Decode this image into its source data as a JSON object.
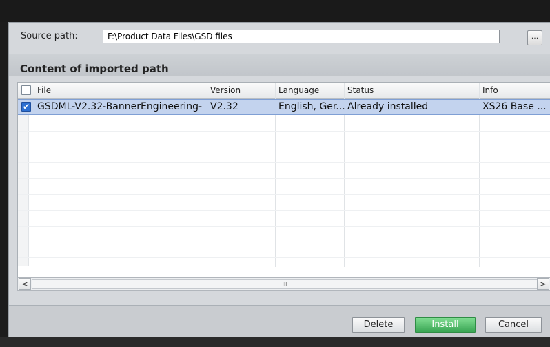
{
  "source": {
    "label": "Source path:",
    "value": "F:\\Product Data Files\\GSD files",
    "browse_label": "..."
  },
  "section": {
    "title": "Content of imported path"
  },
  "table": {
    "headers": {
      "file": "File",
      "version": "Version",
      "language": "Language",
      "status": "Status",
      "info": "Info"
    },
    "rows": [
      {
        "checked": true,
        "file": "GSDML-V2.32-BannerEngineering-",
        "version": "V2.32",
        "language": "English, Ger...",
        "status": "Already installed",
        "info": "XS26 Base ..."
      }
    ]
  },
  "scrollbar": {
    "left_label": "<",
    "thumb_label": "III",
    "right_label": ">"
  },
  "buttons": {
    "delete": "Delete",
    "install": "Install",
    "cancel": "Cancel"
  },
  "colors": {
    "selection": "#c3d3ee",
    "install_button": "#3aa654",
    "checkbox": "#2c6fd1"
  },
  "icons": {
    "checkbox_checked": "check-icon"
  }
}
